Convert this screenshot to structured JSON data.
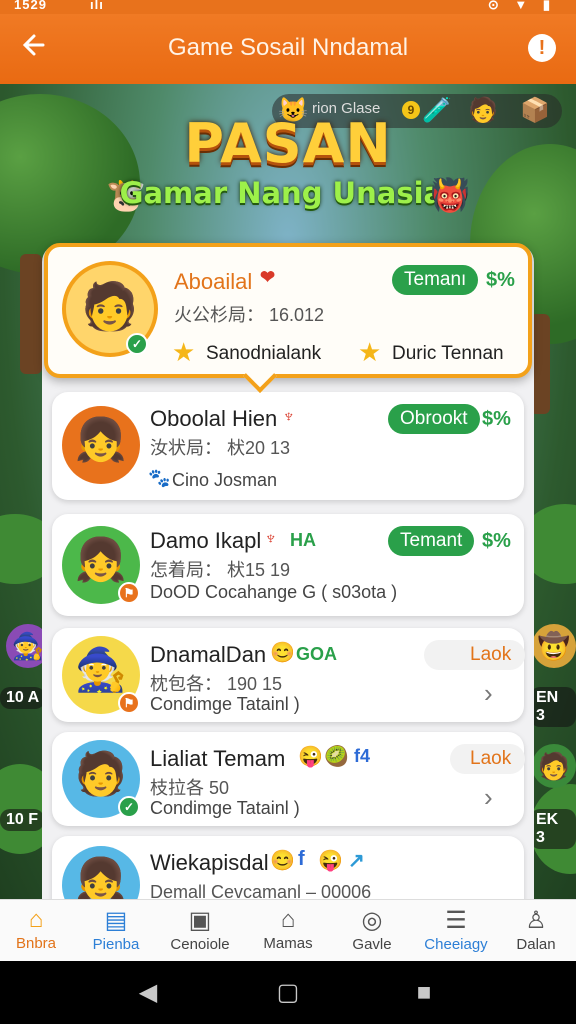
{
  "status_bar": {
    "time": "1529",
    "left_extra": "ılı",
    "right_icons": "⊙ ▼ ▮"
  },
  "app_bar": {
    "title": "Game Sosail Nndamal",
    "back_icon": "arrow-left-icon",
    "alert_icon": "!"
  },
  "banner": {
    "top_label": "rion Glase",
    "coin_value": "9",
    "logo": "PASAN",
    "tagline": "Gamar Nang Unasia!"
  },
  "friends": [
    {
      "name": "Aboailal",
      "sub": "火公杉局： 16.012",
      "status": "Temanı",
      "percent": "$%",
      "stars": [
        "Sanodnialank",
        "Duric Tennan"
      ],
      "avatar_bg": "#ffd56b",
      "featured": true
    },
    {
      "name": "Oboolal Hien",
      "sub": "汝状局： 枤20 13",
      "status": "Obrookt",
      "percent": "$%",
      "note": "Cino Josman",
      "avatar_bg": "#e8721c"
    },
    {
      "name": "Damo Ikapl",
      "tag": "HA",
      "sub": "怎着局： 枤15 19",
      "status": "Temant",
      "percent": "$%",
      "note": "DoOD Cocahange G ( s03ota )",
      "avatar_bg": "#4cb84a"
    },
    {
      "name": "DnamalDan",
      "tag": "GOA",
      "sub": "枕包各： 190 15",
      "action": "Laok",
      "note": "Condimge Tatainl )",
      "avatar_bg": "#f5d94a"
    },
    {
      "name": "Lialiat Temam",
      "tag": "f4",
      "sub": "枝拉各 50",
      "action": "Laok",
      "note": "Condimge Tatainl )",
      "avatar_bg": "#57b8e6"
    },
    {
      "name": "Wiekapisdal",
      "sub": "Demall Cevcamanl – 00006",
      "avatar_bg": "#57b8e6"
    }
  ],
  "side_labels": {
    "left_top": "10 A",
    "left_bottom": "10 F",
    "right_top": "EN 3",
    "right_bottom": "EK 3"
  },
  "nav": [
    {
      "label": "Bnbra",
      "icon": "home-icon",
      "active": true
    },
    {
      "label": "Pienba",
      "icon": "list-icon",
      "blue": true
    },
    {
      "label": "Cenoiole",
      "icon": "badge-icon"
    },
    {
      "label": "Mamas",
      "icon": "house-icon"
    },
    {
      "label": "Gavle",
      "icon": "globe-icon"
    },
    {
      "label": "Cheeiagy",
      "icon": "stack-icon",
      "blue": true
    },
    {
      "label": "Dalan",
      "icon": "person-icon"
    }
  ],
  "colors": {
    "accent": "#e8721c",
    "green": "#2aa04a",
    "gold": "#f3a11a"
  }
}
